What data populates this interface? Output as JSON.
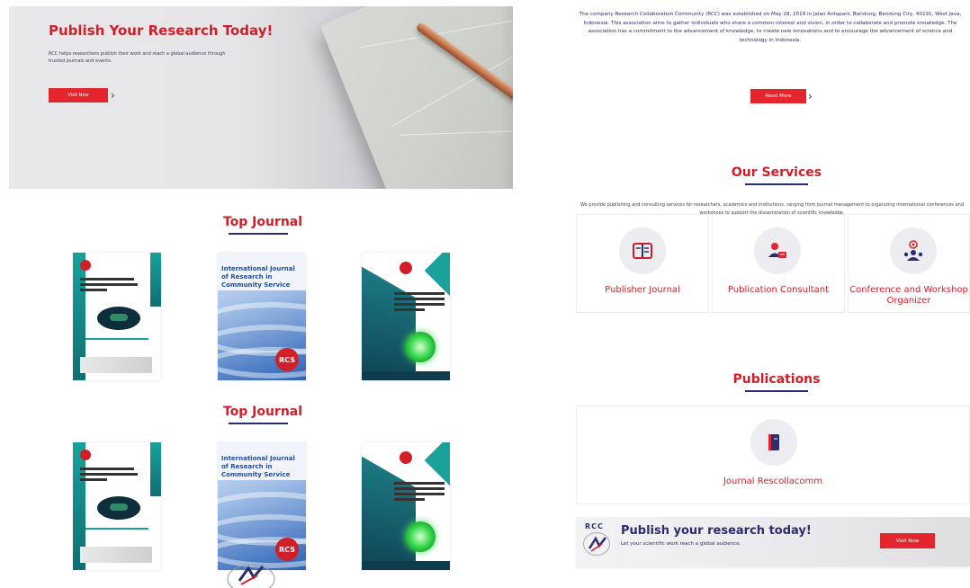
{
  "hero": {
    "title": "Publish Your Research Today!",
    "text": "RCC helps researchers publish their work and reach a global audience through trusted journals and events.",
    "button": "Visit Now"
  },
  "journals": {
    "section_title": "Top Journal",
    "covers": [
      {
        "style": "teal",
        "name": "International Journal of Business, Economics and Social Development (IJBESD)"
      },
      {
        "style": "blue",
        "name": "International Journal of Research in Community Service"
      },
      {
        "style": "dark",
        "name": "International Journal of Quantitative Research and Modeling (IJQRM)"
      }
    ]
  },
  "about": {
    "text": "The company Research Collaboration Community (RCC) was established on May 28, 2019 in Jalan Antapani, Bandung, Bandung City, 40291, West Java, Indonesia. This association aims to gather individuals who share a common interest and vision, in order to collaborate and promote knowledge. The association has a commitment to the advancement of knowledge, to create new innovations and to encourage the advancement of science and technology in Indonesia.",
    "button": "Read More"
  },
  "services": {
    "title": "Our Services",
    "description": "We provide publishing and consulting services for researchers, academics and institutions, ranging from journal management to organizing international conferences and workshops to support the dissemination of scientific knowledge.",
    "items": [
      {
        "label": "Publisher Journal",
        "icon": "book-icon"
      },
      {
        "label": "Publication Consultant",
        "icon": "consultant-icon"
      },
      {
        "label": "Conference and Workshop Organizer",
        "icon": "conference-icon"
      }
    ]
  },
  "publications": {
    "title": "Publications",
    "items": [
      {
        "label": "Journal Rescollacomm",
        "icon": "notebook-icon"
      }
    ]
  },
  "banner": {
    "logo": "RCC",
    "title": "Publish your research today!",
    "subtitle": "Let your scientific work reach a global audience.",
    "button": "Visit Now"
  },
  "colors": {
    "accent": "#e3252e",
    "navy": "#2b2d6e",
    "card_icon_bg": "#ececf1"
  }
}
